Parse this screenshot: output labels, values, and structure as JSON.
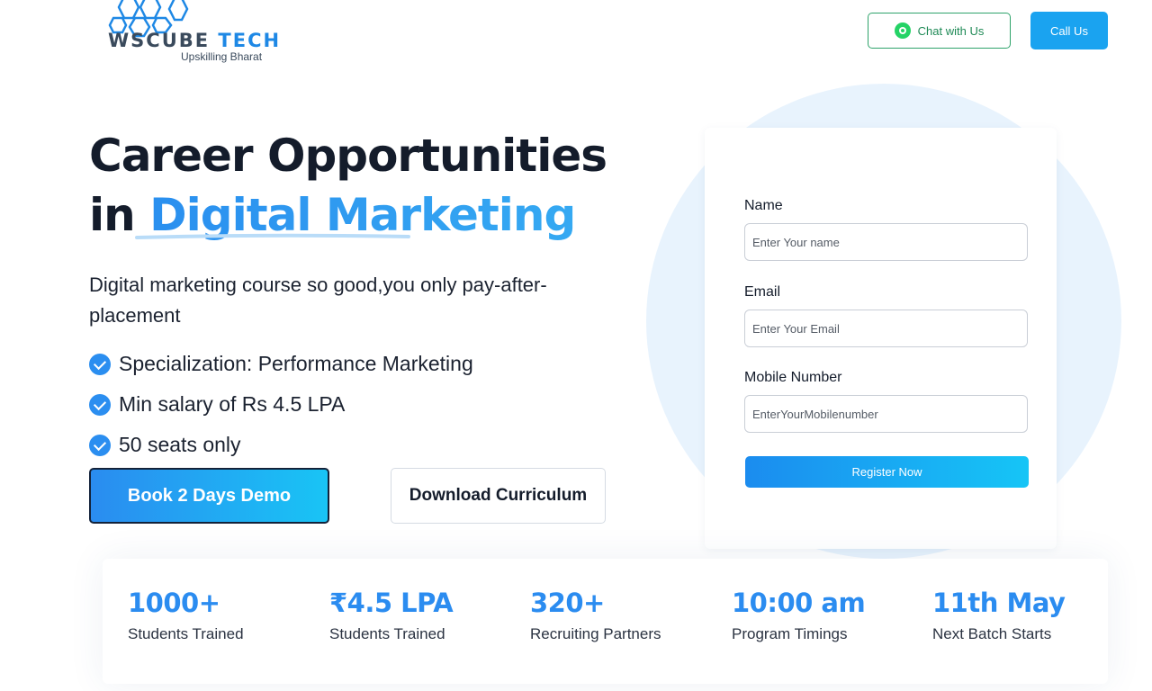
{
  "header": {
    "logo_name": "WsCube",
    "logo_tech": "Tech",
    "logo_tagline": "Upskilling Bharat",
    "chat_label": "Chat with Us",
    "call_label": "Call Us"
  },
  "hero": {
    "title_line1": "Career Opportunities",
    "title_prefix": "in ",
    "title_accent": "Digital Marketing",
    "subtitle": "Digital marketing course so good,you only pay-after-placement",
    "features": [
      "Specialization: Performance Marketing",
      "Min salary of Rs 4.5 LPA",
      "50 seats only"
    ],
    "demo_button": "Book 2 Days Demo",
    "curriculum_button": "Download Curriculum"
  },
  "form": {
    "name_label": "Name",
    "name_placeholder": "Enter Your name",
    "email_label": "Email",
    "email_placeholder": "Enter Your Email",
    "mobile_label": "Mobile Number",
    "mobile_placeholder": "EnterYourMobilenumber",
    "submit_label": "Register Now"
  },
  "stats": [
    {
      "value": "1000+",
      "label": "Students Trained"
    },
    {
      "value": "₹4.5 LPA",
      "label": "Students Trained"
    },
    {
      "value": "320+",
      "label": "Recruiting Partners"
    },
    {
      "value": "10:00 am",
      "label": "Program Timings"
    },
    {
      "value": "11th May",
      "label": "Next Batch Starts"
    }
  ],
  "colors": {
    "accent": "#2b8cf0",
    "whatsapp": "#25d366",
    "call_button": "#1aa3f0",
    "circle_bg": "#e8f3fd"
  }
}
